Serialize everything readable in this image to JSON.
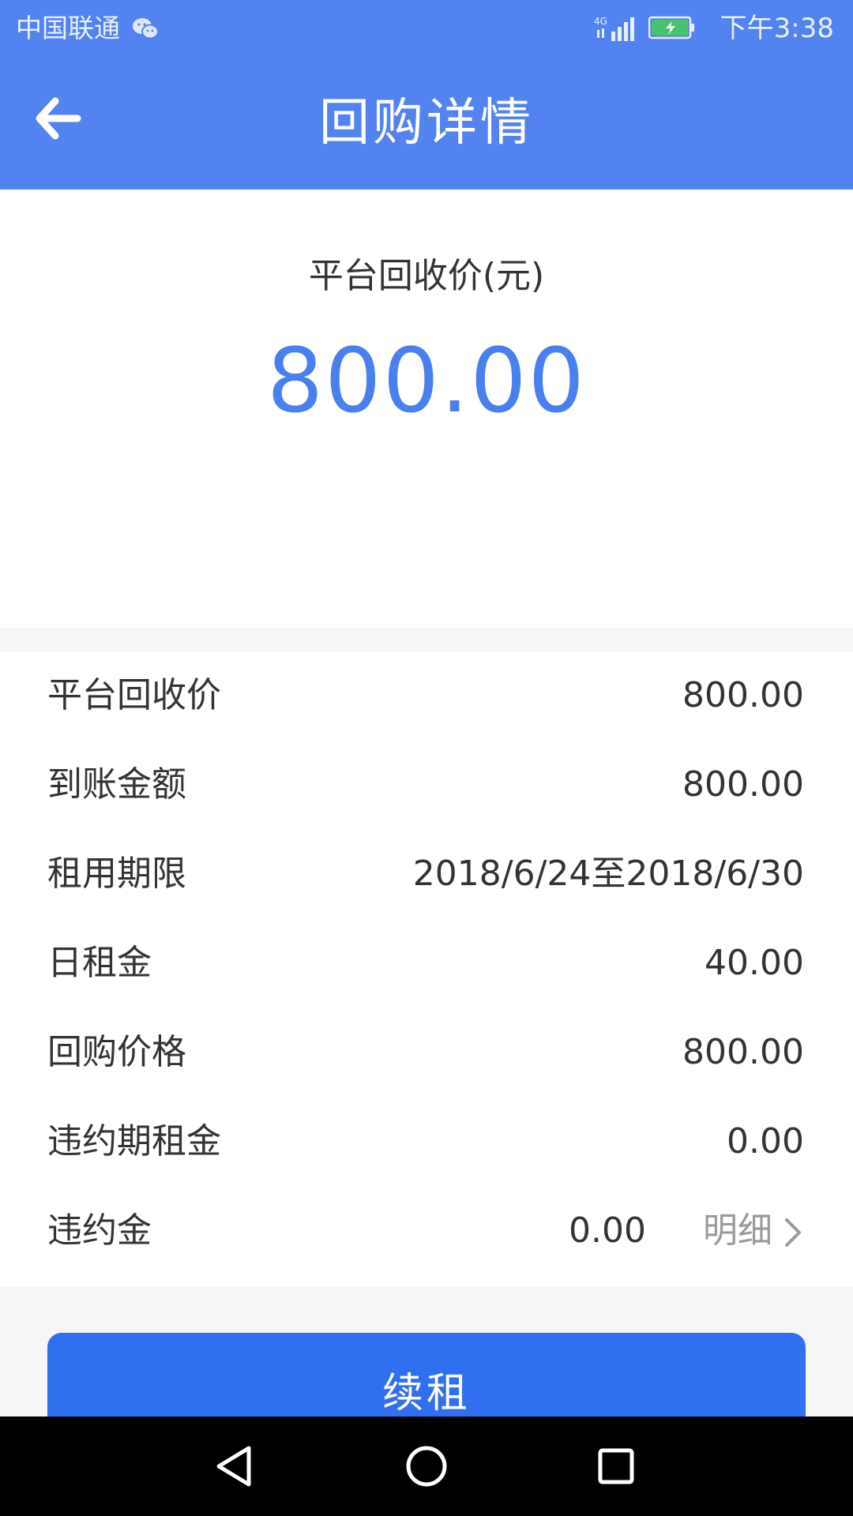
{
  "status_bar": {
    "carrier": "中国联通",
    "network": "4G",
    "time": "下午3:38"
  },
  "header": {
    "title": "回购详情"
  },
  "hero": {
    "label": "平台回收价(元)",
    "amount": "800.00",
    "amount_color": "#4a7ff0"
  },
  "details": {
    "rows": [
      {
        "label": "平台回收价",
        "value": "800.00"
      },
      {
        "label": "到账金额",
        "value": "800.00"
      },
      {
        "label": "租用期限",
        "value": "2018/6/24至2018/6/30"
      },
      {
        "label": "日租金",
        "value": "40.00"
      },
      {
        "label": "回购价格",
        "value": "800.00"
      },
      {
        "label": "违约期租金",
        "value": "0.00"
      },
      {
        "label": "违约金",
        "value": "0.00",
        "link": "明细"
      }
    ]
  },
  "actions": {
    "renew_label": "续租"
  },
  "colors": {
    "header_bg": "#5283f1",
    "button_bg": "#2f6ff0",
    "page_bg": "#f6f6f6"
  }
}
